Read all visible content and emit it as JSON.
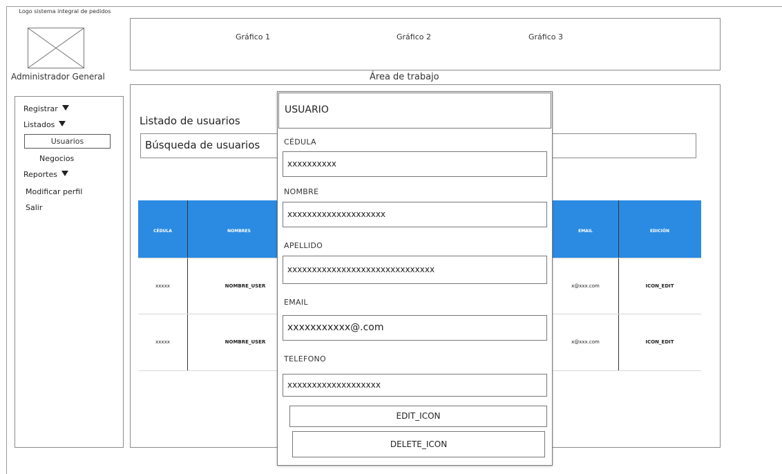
{
  "logo": {
    "text": "Logo sistema integral de pedidos",
    "icon": "image-placeholder-icon"
  },
  "user_role": "Administrador General",
  "charts": [
    "Gráfico 1",
    "Gráfico 2",
    "Gráfico 3"
  ],
  "work_area_label": "Área de trabajo",
  "sidebar": {
    "items": [
      {
        "label": "Registrar",
        "icon": "triangle-down-icon"
      },
      {
        "label": "Listados",
        "icon": "triangle-down-icon"
      },
      {
        "label": "Usuarios"
      },
      {
        "label": "Negocios"
      },
      {
        "label": "Reportes",
        "icon": "triangle-down-icon"
      },
      {
        "label": "Modificar perfil"
      },
      {
        "label": "Salir"
      }
    ]
  },
  "list": {
    "title": "Listado de usuarios",
    "search_placeholder": "Búsqueda de usuarios"
  },
  "table": {
    "header_color": "#2b8be3",
    "columns": {
      "cedula": "CÉDULA",
      "nombres": "NOMBRES",
      "email": "EMAIL",
      "edicion": "EDICIÓN"
    },
    "rows": [
      {
        "cedula": "xxxxx",
        "nombres": "NOMBRE_USER",
        "email": "x@xxx.com",
        "edicion": "ICON_EDIT"
      },
      {
        "cedula": "xxxxx",
        "nombres": "NOMBRE_USER",
        "email": "x@xxx.com",
        "edicion": "ICON_EDIT"
      }
    ]
  },
  "modal": {
    "title": "USUARIO",
    "fields": {
      "cedula": {
        "label": "CÉDULA",
        "value": "xxxxxxxxxx"
      },
      "nombre": {
        "label": "NOMBRE",
        "value": "xxxxxxxxxxxxxxxxxxxx"
      },
      "apellido": {
        "label": "APELLIDO",
        "value": "xxxxxxxxxxxxxxxxxxxxxxxxxxxxxx"
      },
      "email": {
        "label": "EMAIL",
        "value": "xxxxxxxxxxx@.com"
      },
      "telefono": {
        "label": "TELEFONO",
        "value": "xxxxxxxxxxxxxxxxxxx"
      }
    },
    "edit_button": "EDIT_ICON",
    "delete_button": "DELETE_ICON"
  }
}
